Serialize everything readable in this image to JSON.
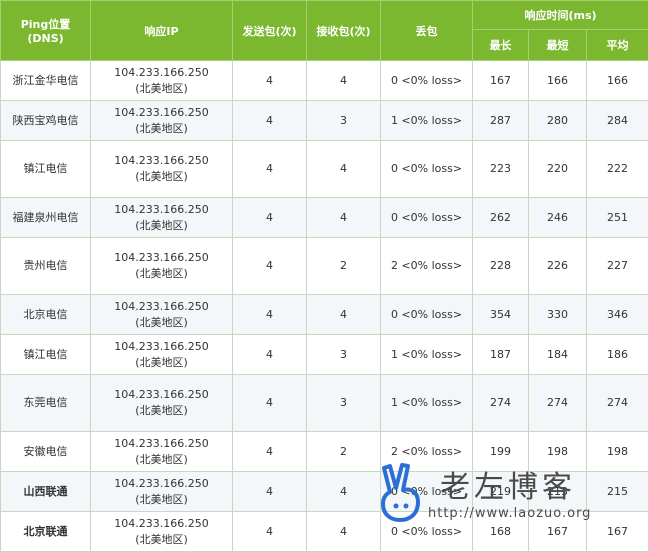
{
  "headers": {
    "location_line1": "Ping位置",
    "location_line2": "(DNS)",
    "ip": "响应IP",
    "sent": "发送包(次)",
    "received": "接收包(次)",
    "loss": "丢包",
    "response_time": "响应时间(ms)",
    "max": "最长",
    "min": "最短",
    "avg": "平均"
  },
  "rows": [
    {
      "location": "浙江金华电信",
      "ip": "104.233.166.250",
      "region": "(北美地区)",
      "sent": "4",
      "received": "4",
      "loss": "0 <0% loss>",
      "max": "167",
      "min": "166",
      "avg": "166"
    },
    {
      "location": "陕西宝鸡电信",
      "ip": "104.233.166.250",
      "region": "(北美地区)",
      "sent": "4",
      "received": "3",
      "loss": "1 <0% loss>",
      "max": "287",
      "min": "280",
      "avg": "284"
    },
    {
      "location": "镇江电信",
      "ip": "104.233.166.250",
      "region": "(北美地区)",
      "sent": "4",
      "received": "4",
      "loss": "0 <0% loss>",
      "max": "223",
      "min": "220",
      "avg": "222"
    },
    {
      "location": "福建泉州电信",
      "ip": "104.233.166.250",
      "region": "(北美地区)",
      "sent": "4",
      "received": "4",
      "loss": "0 <0% loss>",
      "max": "262",
      "min": "246",
      "avg": "251"
    },
    {
      "location": "贵州电信",
      "ip": "104.233.166.250",
      "region": "(北美地区)",
      "sent": "4",
      "received": "2",
      "loss": "2 <0% loss>",
      "max": "228",
      "min": "226",
      "avg": "227"
    },
    {
      "location": "北京电信",
      "ip": "104.233.166.250",
      "region": "(北美地区)",
      "sent": "4",
      "received": "4",
      "loss": "0 <0% loss>",
      "max": "354",
      "min": "330",
      "avg": "346"
    },
    {
      "location": "镇江电信",
      "ip": "104.233.166.250",
      "region": "(北美地区)",
      "sent": "4",
      "received": "3",
      "loss": "1 <0% loss>",
      "max": "187",
      "min": "184",
      "avg": "186"
    },
    {
      "location": "东莞电信",
      "ip": "104.233.166.250",
      "region": "(北美地区)",
      "sent": "4",
      "received": "3",
      "loss": "1 <0% loss>",
      "max": "274",
      "min": "274",
      "avg": "274"
    },
    {
      "location": "安徽电信",
      "ip": "104.233.166.250",
      "region": "(北美地区)",
      "sent": "4",
      "received": "2",
      "loss": "2 <0% loss>",
      "max": "199",
      "min": "198",
      "avg": "198"
    },
    {
      "location": "山西联通",
      "ip": "104.233.166.250",
      "region": "(北美地区)",
      "sent": "4",
      "received": "4",
      "loss": "0 <0% loss>",
      "max": "219",
      "min": "213",
      "avg": "215"
    },
    {
      "location": "北京联通",
      "ip": "104.233.166.250",
      "region": "(北美地区)",
      "sent": "4",
      "received": "4",
      "loss": "0 <0% loss>",
      "max": "168",
      "min": "167",
      "avg": "167"
    }
  ],
  "watermark": {
    "title": "老左博客",
    "url": "http://www.laozuo.org"
  },
  "colors": {
    "header_bg": "#7bb72f",
    "header_text": "#ffffff",
    "row_alt_bg": "#f3f7fa",
    "watermark_icon": "#2b6fd6"
  }
}
